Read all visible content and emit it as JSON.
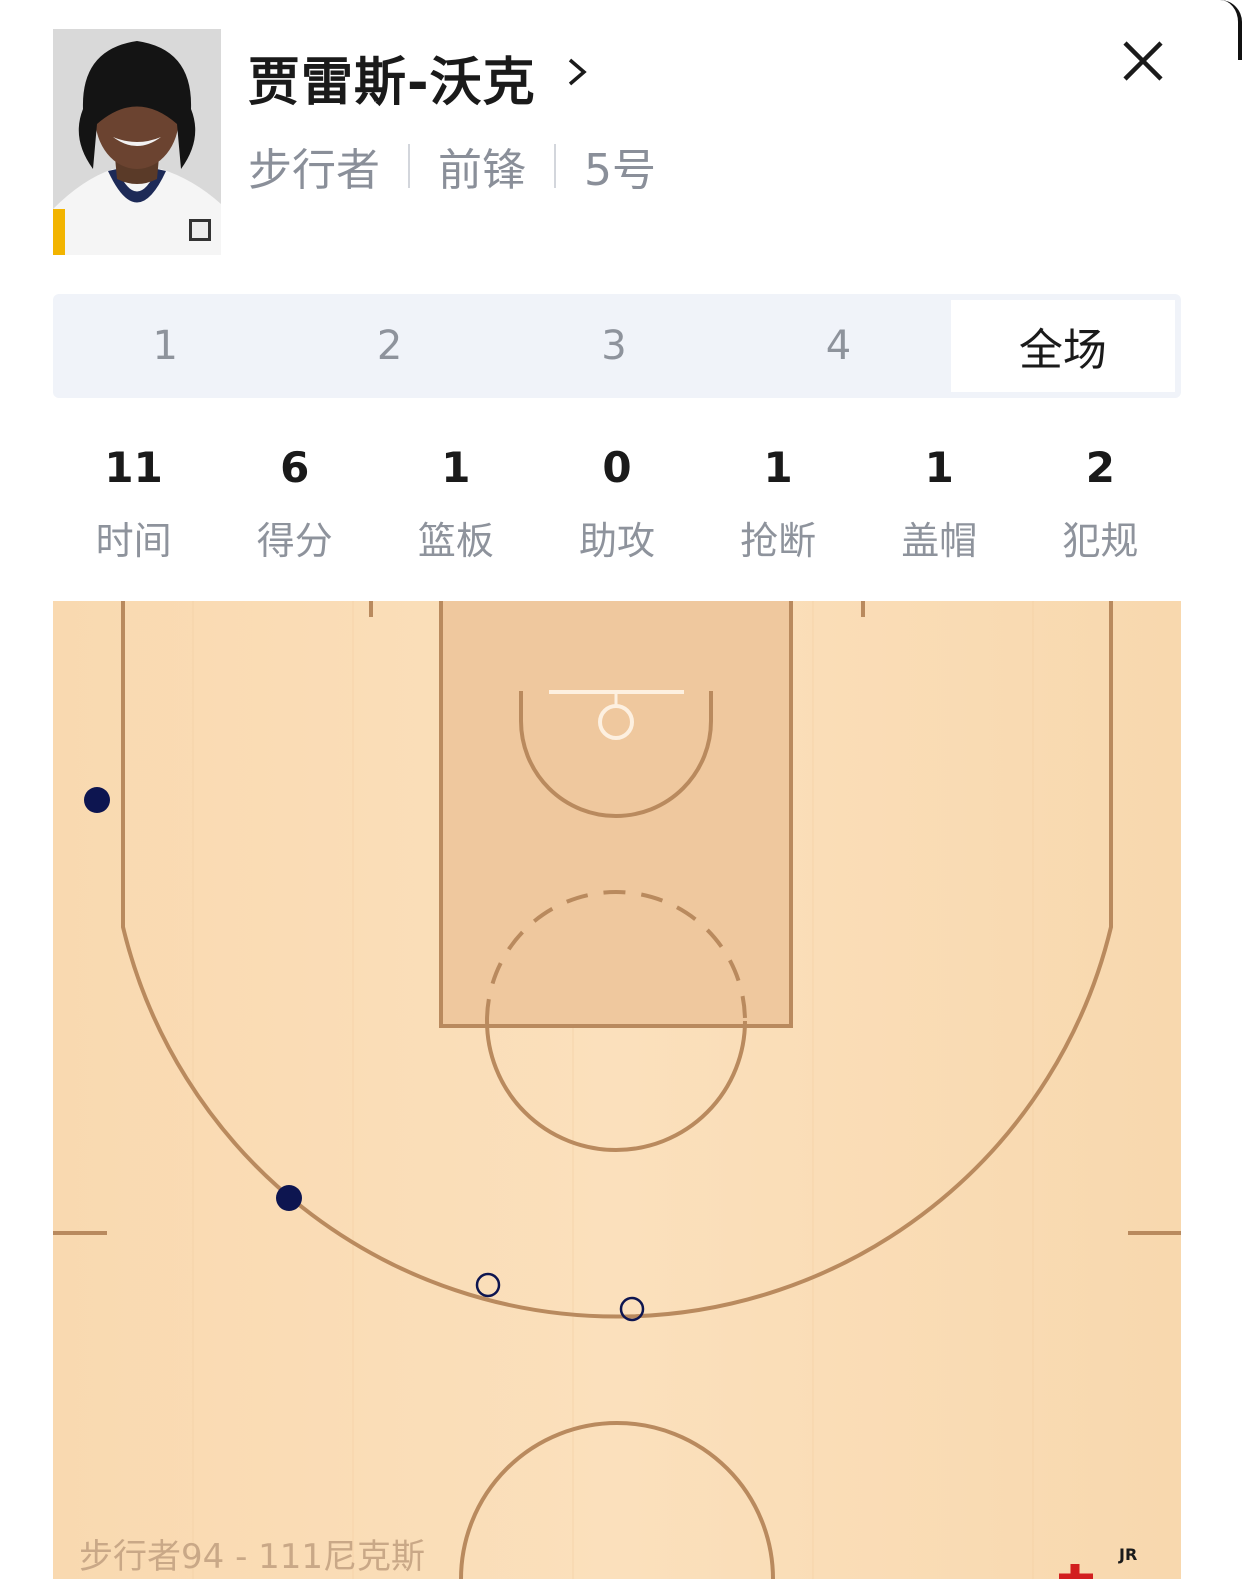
{
  "player": {
    "name": "贾雷斯-沃克",
    "team": "步行者",
    "position": "前锋",
    "number": "5号",
    "jersey_colors": {
      "primary": "#f4f4f4",
      "trim": "#1d2a57",
      "accent": "#f2b400"
    }
  },
  "icons": {
    "chevron": "chevron-right-icon",
    "close": "close-icon"
  },
  "tabs": [
    {
      "label": "1",
      "active": false
    },
    {
      "label": "2",
      "active": false
    },
    {
      "label": "3",
      "active": false
    },
    {
      "label": "4",
      "active": false
    },
    {
      "label": "全场",
      "active": true
    }
  ],
  "stats": [
    {
      "value": "11",
      "label": "时间"
    },
    {
      "value": "6",
      "label": "得分"
    },
    {
      "value": "1",
      "label": "篮板"
    },
    {
      "value": "0",
      "label": "助攻"
    },
    {
      "value": "1",
      "label": "抢断"
    },
    {
      "value": "1",
      "label": "盖帽"
    },
    {
      "value": "2",
      "label": "犯规"
    }
  ],
  "shot_chart": {
    "legend": {
      "made": "filled circle",
      "missed": "hollow circle"
    },
    "shots": [
      {
        "result": "made",
        "zone": "left corner/wing three"
      },
      {
        "result": "made",
        "zone": "left wing three"
      },
      {
        "result": "missed",
        "zone": "top of key three"
      },
      {
        "result": "missed",
        "zone": "top of key three"
      }
    ],
    "colors": {
      "court": "#fadcb4",
      "paint": "#efc79c",
      "lines": "#b98a5e",
      "shot": "#0d1550"
    }
  },
  "score_line": "步行者94 - 111尼克斯",
  "watermark": {
    "text": "JR"
  }
}
